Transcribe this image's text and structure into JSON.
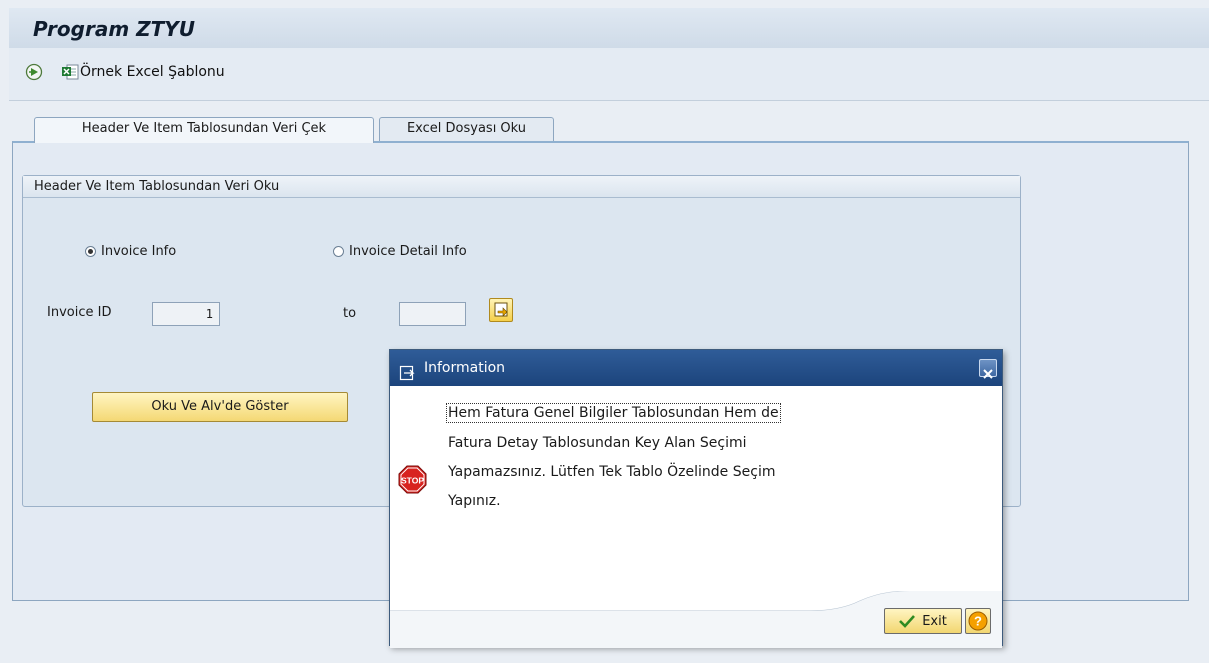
{
  "window": {
    "title": "Program ZTYU"
  },
  "toolbar": {
    "excel_template_label": "Örnek Excel Şablonu"
  },
  "tabs": [
    {
      "label": "Header Ve Item Tablosundan Veri Çek",
      "active": true
    },
    {
      "label": "Excel Dosyası Oku",
      "active": false
    }
  ],
  "group": {
    "title": "Header Ve Item Tablosundan Veri Oku",
    "radio_invoice_info": {
      "label": "Invoice Info",
      "selected": true
    },
    "radio_invoice_detail": {
      "label": "Invoice Detail Info",
      "selected": false
    },
    "invoice_id_label": "Invoice ID",
    "invoice_id_from": "1",
    "to_label": "to",
    "invoice_id_to": "",
    "show_button_label": "Oku Ve Alv'de Göster"
  },
  "dialog": {
    "title": "Information",
    "message_lines": [
      "Hem Fatura Genel Bilgiler Tablosundan Hem de",
      "Fatura Detay Tablosundan Key Alan Seçimi",
      "Yapamazsınız. Lütfen Tek Tablo Özelinde Seçim",
      "Yapınız."
    ],
    "exit_label": "Exit"
  }
}
